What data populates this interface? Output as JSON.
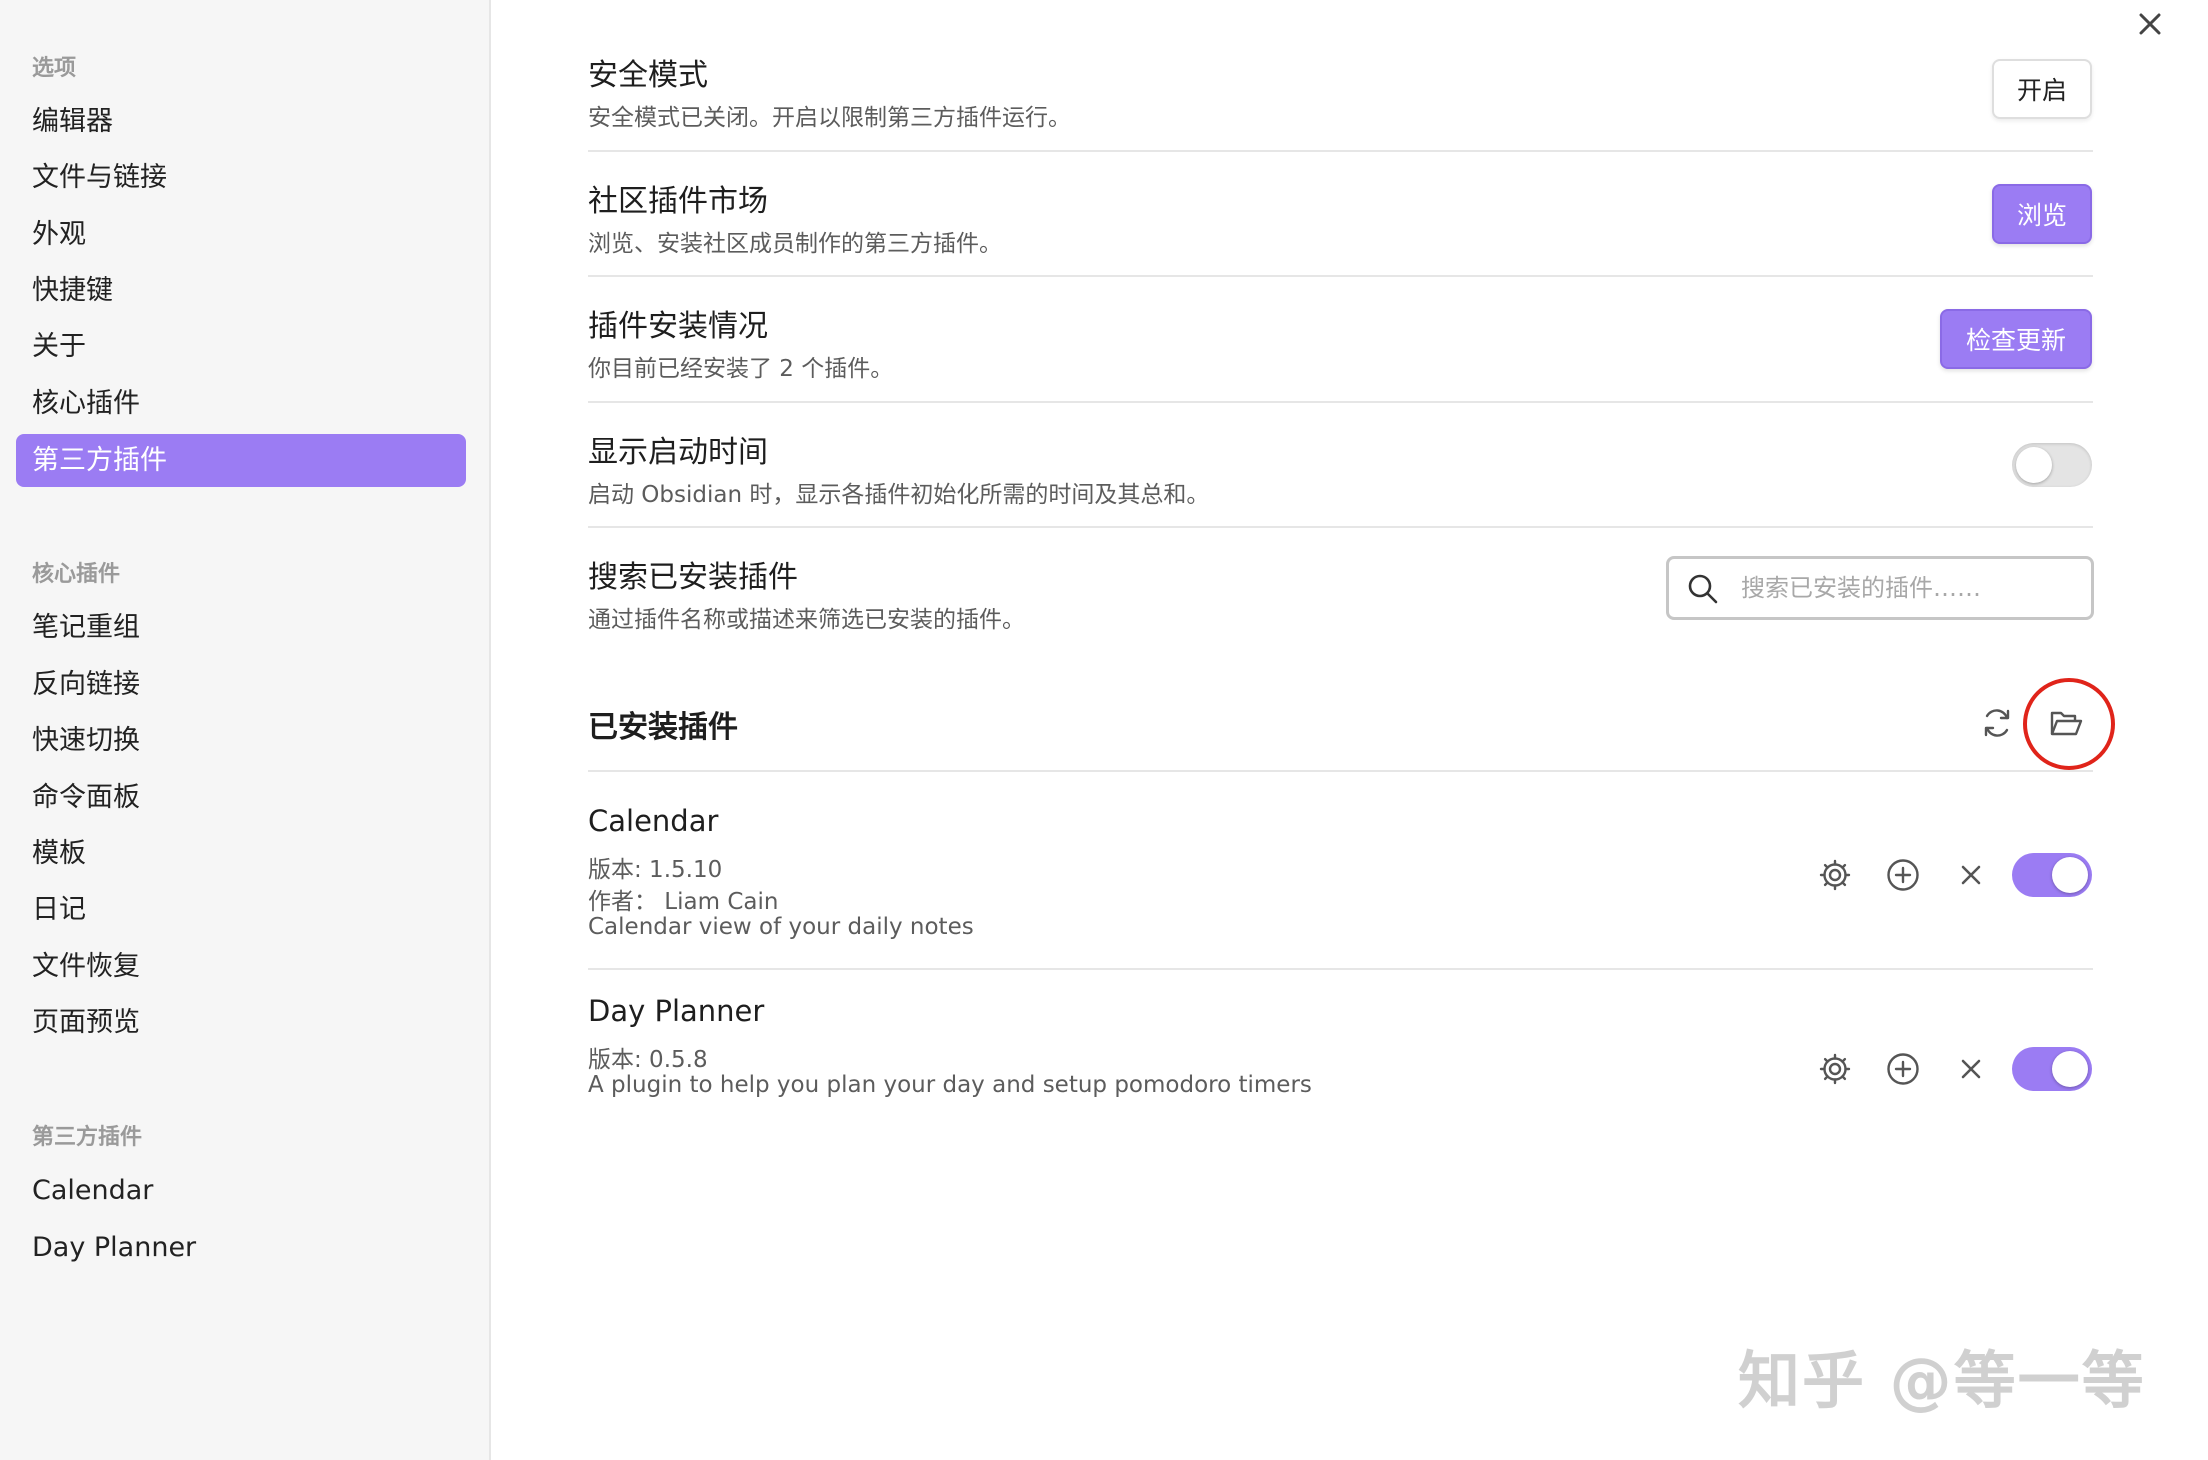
{
  "sidebar": {
    "options_heading": "选项",
    "options": [
      "编辑器",
      "文件与链接",
      "外观",
      "快捷键",
      "关于",
      "核心插件",
      "第三方插件"
    ],
    "active_option": "第三方插件",
    "core_heading": "核心插件",
    "core_plugins": [
      "笔记重组",
      "反向链接",
      "快速切换",
      "命令面板",
      "模板",
      "日记",
      "文件恢复",
      "页面预览"
    ],
    "community_heading": "第三方插件",
    "community_plugins": [
      "Calendar",
      "Day Planner"
    ]
  },
  "settings": {
    "safe_mode": {
      "name": "安全模式",
      "desc": "安全模式已关闭。开启以限制第三方插件运行。",
      "button": "开启"
    },
    "market": {
      "name": "社区插件市场",
      "desc": "浏览、安装社区成员制作的第三方插件。",
      "button": "浏览"
    },
    "installed_status": {
      "name": "插件安装情况",
      "desc": "你目前已经安装了 2 个插件。",
      "button": "检查更新"
    },
    "startup_time": {
      "name": "显示启动时间",
      "desc": "启动 Obsidian 时，显示各插件初始化所需的时间及其总和。",
      "enabled": false
    },
    "search": {
      "name": "搜索已安装插件",
      "desc": "通过插件名称或描述来筛选已安装的插件。",
      "placeholder": "搜索已安装的插件……",
      "value": ""
    }
  },
  "installed": {
    "title": "已安装插件",
    "plugins": [
      {
        "name": "Calendar",
        "version": "版本: 1.5.10",
        "author": "作者： Liam Cain",
        "desc": "Calendar view of your daily notes",
        "enabled": true
      },
      {
        "name": "Day Planner",
        "version": "版本: 0.5.8",
        "desc": "A plugin to help you plan your day and setup pomodoro timers",
        "enabled": true
      }
    ]
  },
  "watermark": "知乎 @等一等",
  "colors": {
    "accent": "#9b7cf3",
    "highlight_ring": "#e0241a",
    "sidebar_bg": "#f6f6f6"
  },
  "icons": [
    "close-icon",
    "search-icon",
    "reload-icon",
    "folder-open-icon",
    "gear-icon",
    "plus-circle-icon",
    "x-icon"
  ]
}
